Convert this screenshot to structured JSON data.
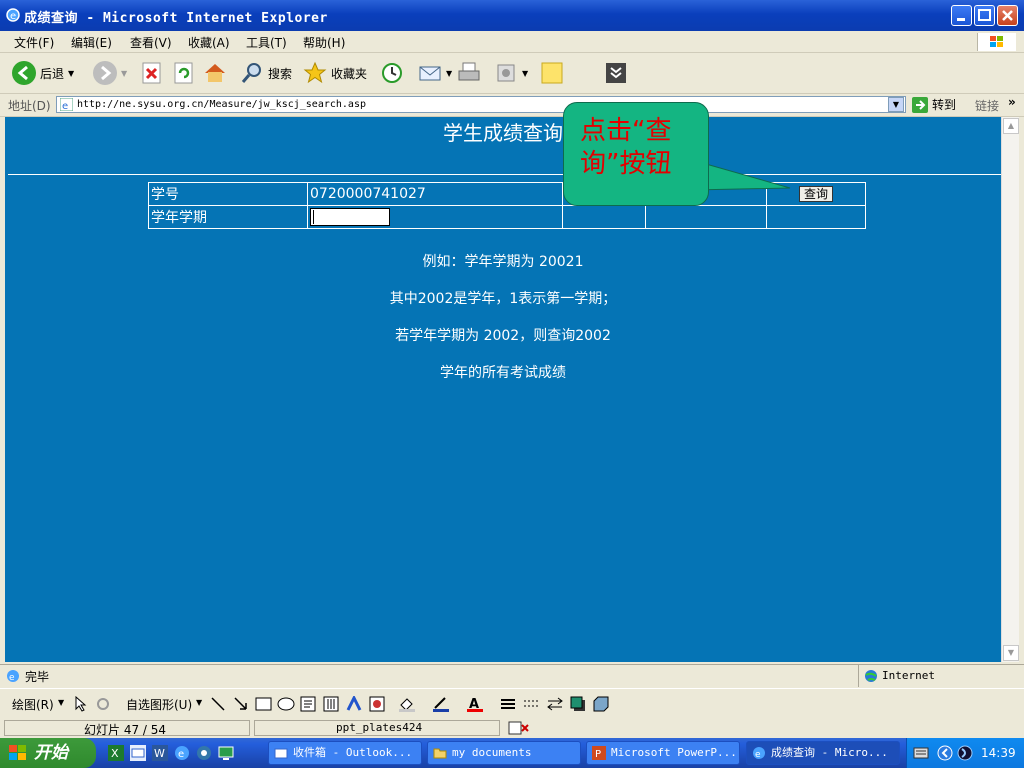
{
  "window": {
    "title": "成绩查询 - Microsoft Internet Explorer"
  },
  "menu": [
    "文件(F)",
    "编辑(E)",
    "查看(V)",
    "收藏(A)",
    "工具(T)",
    "帮助(H)"
  ],
  "toolbar": {
    "back": "后退",
    "search": "搜索",
    "favorites": "收藏夹"
  },
  "address": {
    "label": "地址(D)",
    "url": "http://ne.sysu.org.cn/Measure/jw_kscj_search.asp",
    "go": "转到",
    "links": "链接"
  },
  "page": {
    "title": "学生成绩查询",
    "row1_label": "学号",
    "row1_value": "0720000741027",
    "row2_label": "学年学期",
    "submit": "查询",
    "notes": [
      "例如：学年学期为 20021",
      "其中2002是学年，1表示第一学期；",
      "若学年学期为 2002，则查询2002",
      "学年的所有考试成绩"
    ]
  },
  "callout": {
    "line1": "点击“查",
    "line2": "询”按钮"
  },
  "status": {
    "text": "完毕",
    "zone": "Internet"
  },
  "drawbar": {
    "draw": "绘图(R)",
    "autoshapes": "自选图形(U)"
  },
  "ppt_status": {
    "slide": "幻灯片 47 / 54",
    "template": "ppt_plates424"
  },
  "taskbar": {
    "start": "开始",
    "tasks": [
      "收件箱 - Outlook...",
      "my documents",
      "Microsoft PowerP...",
      "成绩查询 - Micro..."
    ],
    "clock": "14:39"
  },
  "colors": {
    "content_bg": "#0574b5",
    "callout_bg": "#14b582",
    "callout_text": "#e40000"
  }
}
